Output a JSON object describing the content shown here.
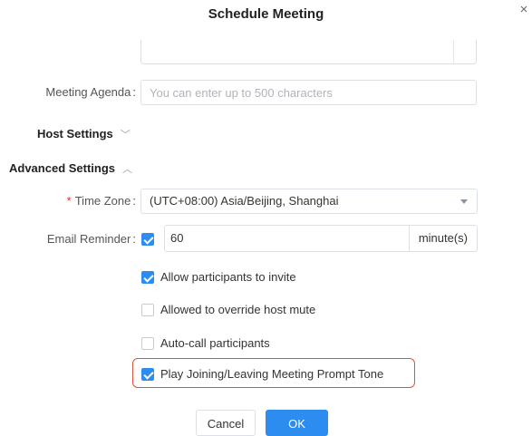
{
  "dialog": {
    "title": "Schedule Meeting",
    "close_glyph": "×"
  },
  "agenda": {
    "label": "Meeting Agenda",
    "colon": ":",
    "placeholder": "You can enter up to 500 characters",
    "value": ""
  },
  "host_settings": {
    "label": "Host Settings",
    "chevron": "chevron-down-icon"
  },
  "advanced_settings": {
    "label": "Advanced Settings",
    "chevron": "chevron-up-icon",
    "time_zone": {
      "required_mark": "*",
      "label": "Time Zone",
      "colon": ":",
      "value": "(UTC+08:00) Asia/Beijing, Shanghai"
    },
    "email_reminder": {
      "label": "Email Reminder",
      "colon": ":",
      "enabled": true,
      "value": "60",
      "unit": "minute(s)"
    }
  },
  "options": [
    {
      "label": "Allow participants to invite",
      "checked": true
    },
    {
      "label": "Allowed to override host mute",
      "checked": false
    },
    {
      "label": "Auto-call participants",
      "checked": false
    },
    {
      "label": "Play Joining/Leaving Meeting Prompt Tone",
      "checked": true
    }
  ],
  "buttons": {
    "cancel": "Cancel",
    "ok": "OK"
  },
  "colors": {
    "accent": "#2d8cf0",
    "highlight_border": "#e0533b",
    "required": "#f5222d"
  }
}
